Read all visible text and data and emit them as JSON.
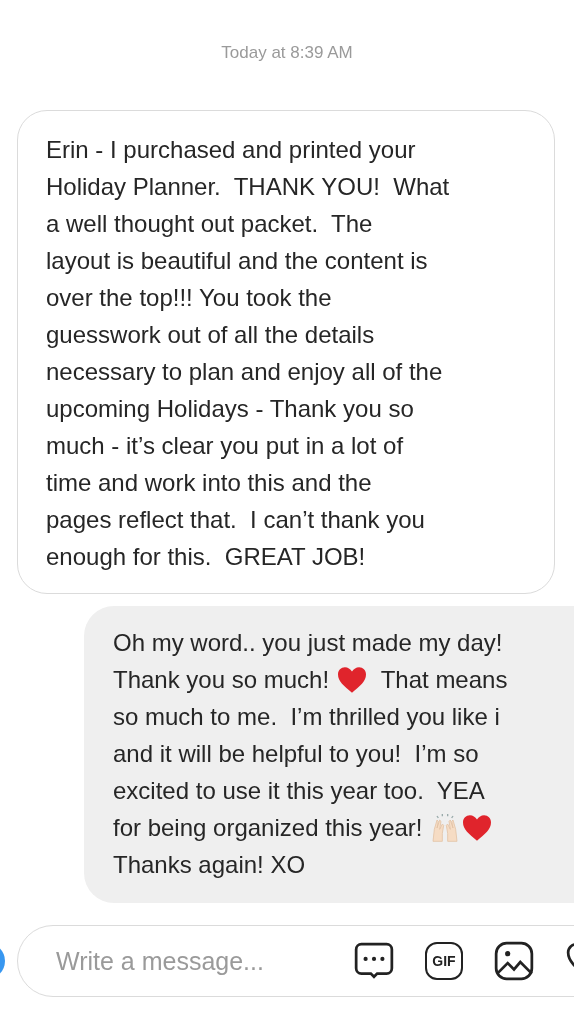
{
  "timestamp": "Today at 8:39 AM",
  "messages": [
    {
      "kind": "received",
      "segments": [
        {
          "kind": "text",
          "text": "Erin - I purchased and printed your\nHoliday Planner.  THANK YOU!  What\na well thought out packet.  The\nlayout is beautiful and the content is\nover the top!!! You took the\nguesswork out of all the details\nnecessary to plan and enjoy all of the\nupcoming Holidays - Thank you so\nmuch - it’s clear you put in a lot of\ntime and work into this and the\npages reflect that.  I can’t thank you\nenough for this.  GREAT JOB!"
        }
      ]
    },
    {
      "kind": "sent",
      "segments": [
        {
          "kind": "text",
          "text": "Oh my word.. you just made my day!"
        },
        {
          "kind": "break"
        },
        {
          "kind": "text",
          "text": "Thank you so much! "
        },
        {
          "kind": "heart"
        },
        {
          "kind": "text",
          "text": "  That means"
        },
        {
          "kind": "break"
        },
        {
          "kind": "text",
          "text": "so much to me.  I’m thrilled you like i"
        },
        {
          "kind": "break"
        },
        {
          "kind": "text",
          "text": "and it will be helpful to you!  I’m so"
        },
        {
          "kind": "break"
        },
        {
          "kind": "text",
          "text": "excited to use it this year too.  YEA"
        },
        {
          "kind": "break"
        },
        {
          "kind": "text",
          "text": "for being organized this year! "
        },
        {
          "kind": "hands"
        },
        {
          "kind": "heart"
        },
        {
          "kind": "break"
        },
        {
          "kind": "text",
          "text": "Thanks again! XO"
        }
      ]
    }
  ],
  "composer": {
    "placeholder": "Write a message...",
    "gif_label": "GIF"
  }
}
